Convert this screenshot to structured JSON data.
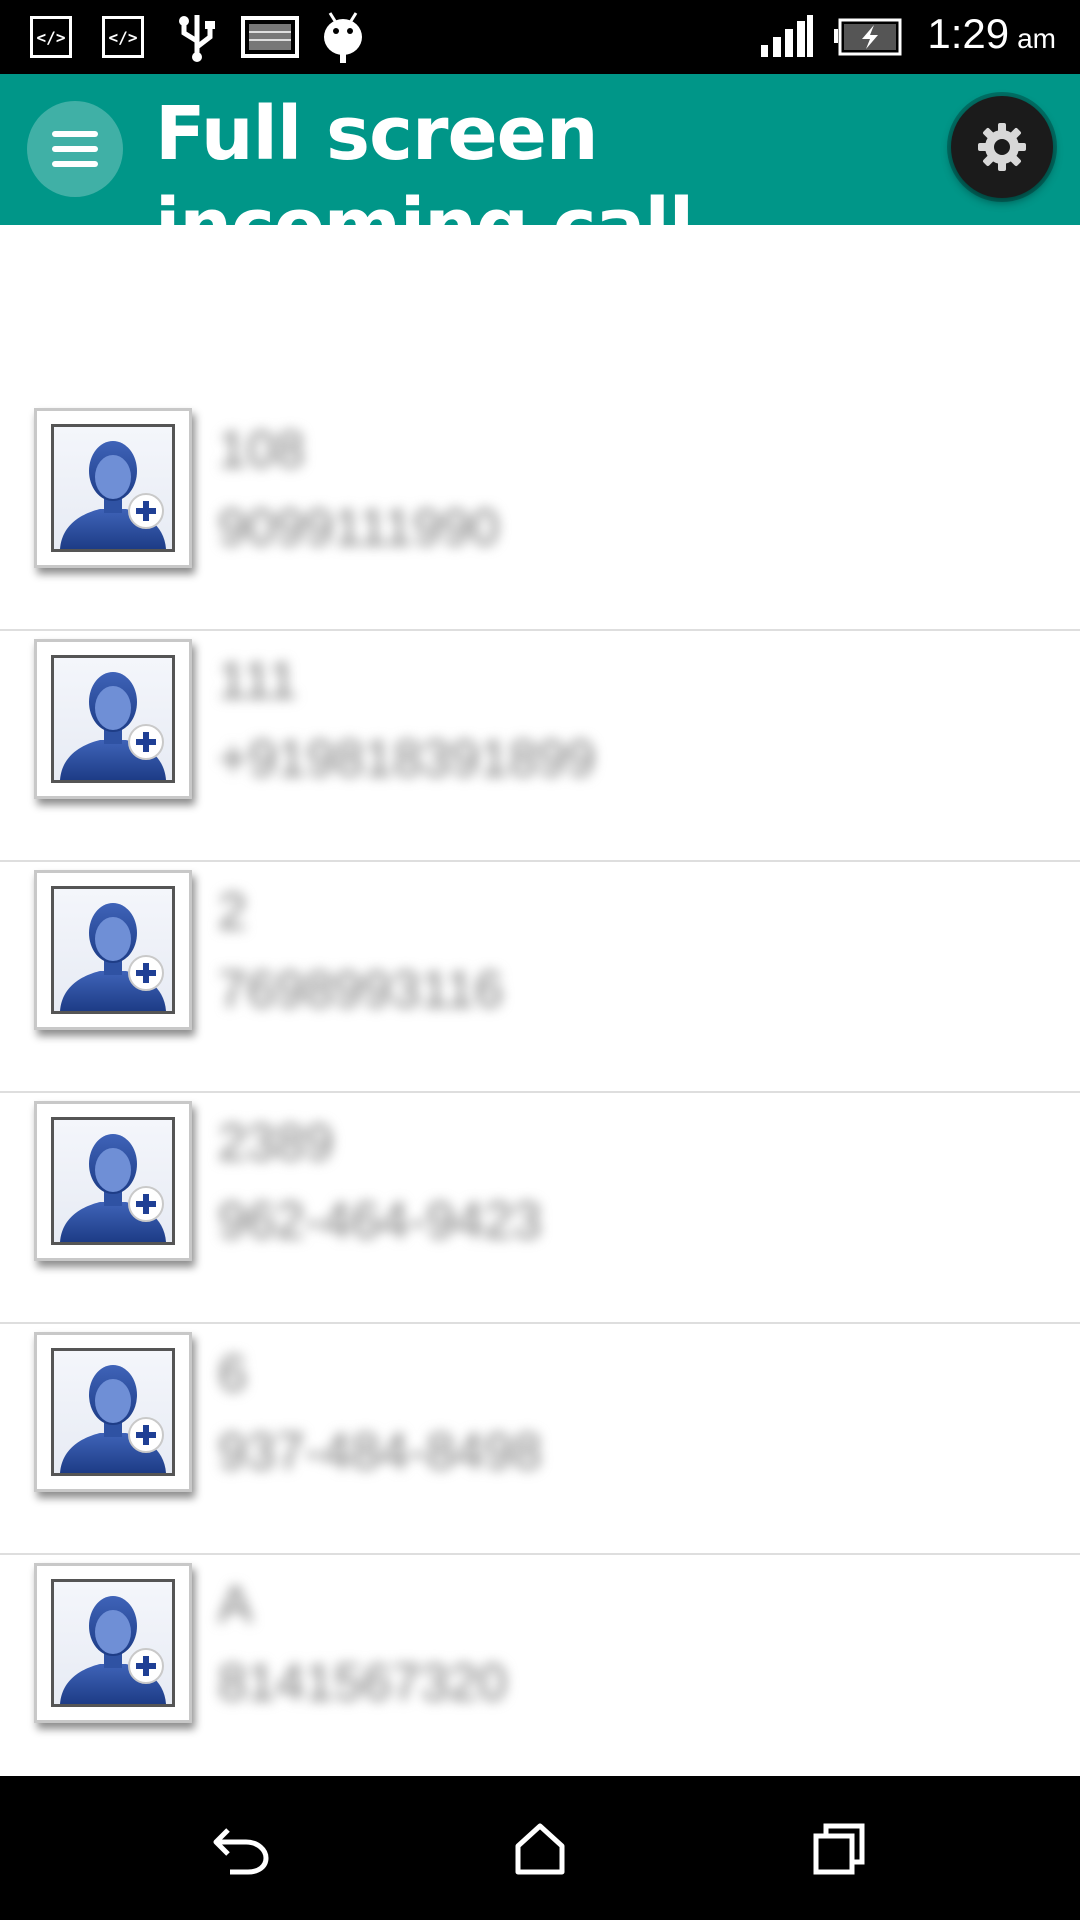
{
  "status_bar": {
    "icons": [
      "code-icon",
      "code-icon",
      "usb-icon",
      "screenshot-icon",
      "android-debug-icon",
      "signal-icon",
      "battery-charging-icon"
    ],
    "time": "1:29",
    "ampm": "am"
  },
  "app_bar": {
    "title": "Full screen incoming call",
    "menu_icon": "hamburger-menu-icon",
    "settings_icon": "gear-icon",
    "color": "#009688"
  },
  "contacts": [
    {
      "name": "108",
      "number": "9099111990"
    },
    {
      "name": "111",
      "number": "+919818391899"
    },
    {
      "name": "2",
      "number": "7698993116"
    },
    {
      "name": "2389",
      "number": "962-464-9423"
    },
    {
      "name": "6",
      "number": "937-484-8498"
    },
    {
      "name": "A",
      "number": "8141567320"
    }
  ],
  "nav_bar": {
    "icons": [
      "back-icon",
      "home-icon",
      "recents-icon"
    ]
  }
}
